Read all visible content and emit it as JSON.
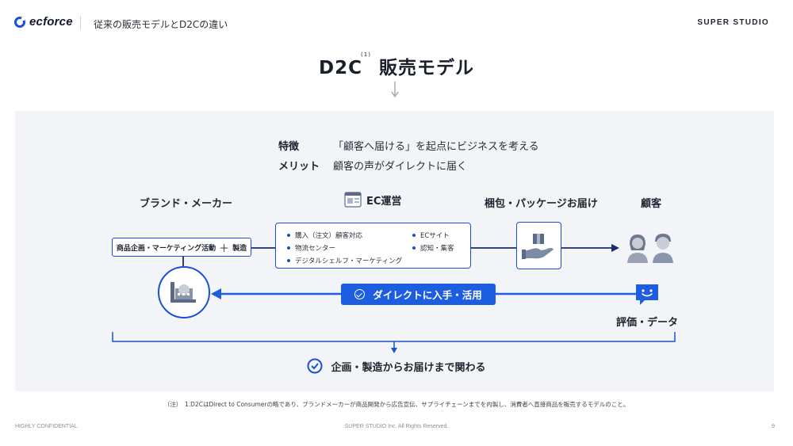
{
  "header": {
    "logo_text": "ecforce",
    "breadcrumb": "従来の販売モデルとD2Cの違い",
    "brand": "SUPER STUDIO"
  },
  "title": {
    "main": "D2C",
    "note": "(1)",
    "suffix": "販売モデル"
  },
  "features": {
    "feature_label": "特徴",
    "feature_text": "「顧客へ届ける」を起点にビジネスを考える",
    "merit_label": "メリット",
    "merit_text": "顧客の声がダイレクトに届く"
  },
  "columns": {
    "maker": "ブランド・メーカー",
    "ec": "EC運営",
    "packing": "梱包・パッケージお届け",
    "customer": "顧客"
  },
  "maker_box": {
    "left": "商品企画・マーケティング活動",
    "plus": "＋",
    "right": "製造"
  },
  "ec_items": [
    "購入（注文）顧客対応",
    "物流センター",
    "デジタルシェルフ・マーケティング",
    "ECサイト",
    "認知・集客"
  ],
  "feedback": {
    "pill": "ダイレクトに入手・活用",
    "label": "評価・データ"
  },
  "bottom": {
    "label": "企画・製造からお届けまで関わる"
  },
  "footnote": "（注）　1.D2CはDirect to Consumerの略であり、ブランドメーカーが商品開発から広告宣伝、サプライチェーンまでを内製し、消費者へ直接商品を販売するモデルのこと。",
  "footer": {
    "left": "HIGHLY CONFIDENTIAL",
    "center": "SUPER STUDIO Inc. All Rights Reserved.",
    "page": "9"
  },
  "colors": {
    "accent": "#1d4fd6",
    "pill": "#1d5ee0",
    "panel": "#f3f4f7",
    "dark_line": "#1a2a6c"
  }
}
